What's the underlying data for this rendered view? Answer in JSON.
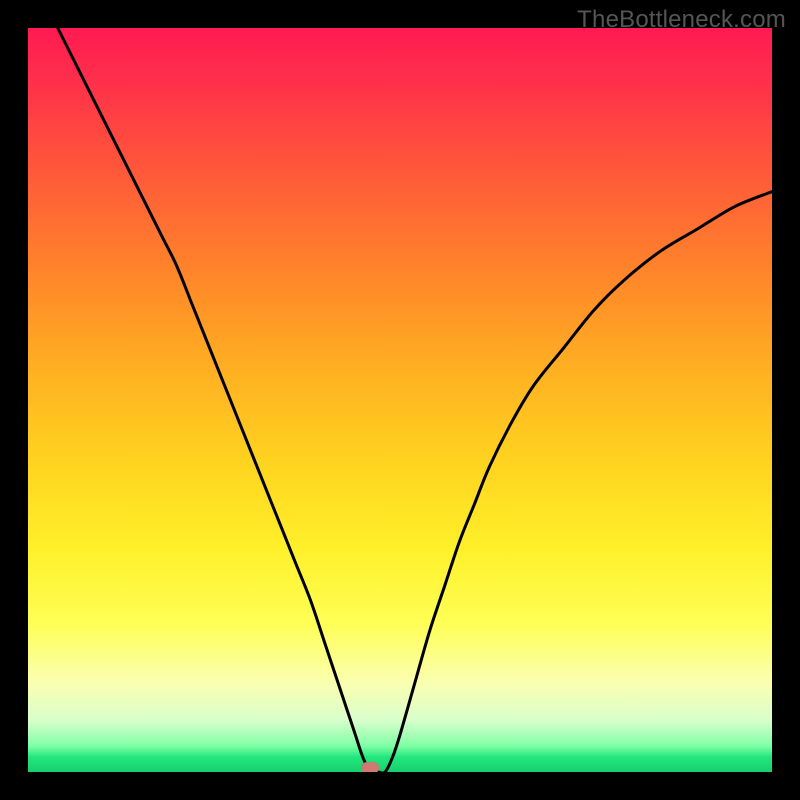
{
  "watermark_text": "TheBottleneck.com",
  "colors": {
    "page_bg": "#000000",
    "watermark": "#555555",
    "curve": "#000000",
    "marker": "#cf7974"
  },
  "chart_data": {
    "type": "line",
    "title": "",
    "xlabel": "",
    "ylabel": "",
    "xlim": [
      0,
      100
    ],
    "ylim": [
      0,
      100
    ],
    "grid": false,
    "legend": false,
    "x": [
      4,
      6,
      8,
      10,
      12,
      14,
      16,
      18,
      20,
      22,
      24,
      26,
      28,
      30,
      32,
      34,
      36,
      38,
      40,
      42,
      43,
      44,
      45,
      46,
      47,
      48,
      49,
      50,
      52,
      54,
      56,
      58,
      60,
      62,
      65,
      68,
      72,
      76,
      80,
      85,
      90,
      95,
      100
    ],
    "values": [
      100,
      96,
      92,
      88,
      84,
      80,
      76,
      72,
      68,
      63,
      58,
      53,
      48,
      43,
      38,
      33,
      28,
      23,
      17,
      11,
      8,
      5,
      2,
      0,
      0,
      0,
      2,
      5,
      12,
      19,
      25,
      31,
      36,
      41,
      47,
      52,
      57,
      62,
      66,
      70,
      73,
      76,
      78
    ],
    "marker": {
      "x": 46,
      "y": 0
    },
    "gradient_stops": [
      {
        "pos": 0.0,
        "color": "#ff1a52"
      },
      {
        "pos": 0.25,
        "color": "#ff6b33"
      },
      {
        "pos": 0.55,
        "color": "#ffd21f"
      },
      {
        "pos": 0.8,
        "color": "#ffff55"
      },
      {
        "pos": 0.95,
        "color": "#7fffa6"
      },
      {
        "pos": 1.0,
        "color": "#16d06e"
      }
    ]
  }
}
